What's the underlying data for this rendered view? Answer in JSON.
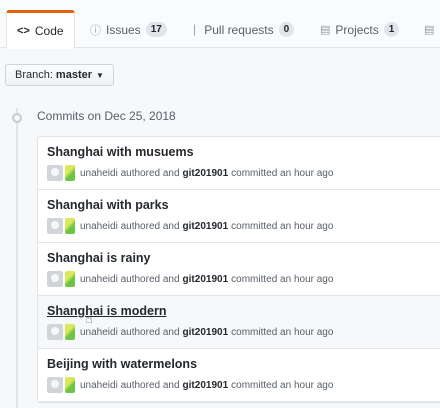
{
  "tabs": [
    {
      "icon": "<>",
      "label": "Code",
      "selected": true
    },
    {
      "icon": "ⓘ",
      "label": "Issues",
      "count": "17"
    },
    {
      "icon": "❘",
      "label": "Pull requests",
      "count": "0"
    },
    {
      "icon": "▤",
      "label": "Projects",
      "count": "1"
    },
    {
      "icon": "▤",
      "label": ""
    }
  ],
  "branch": {
    "prefix": "Branch:",
    "name": "master"
  },
  "commits_header": "Commits on Dec 25, 2018",
  "commits": [
    {
      "title": "Shanghai with musuems",
      "author": "unaheidi",
      "authored_text": "authored and",
      "committer": "git201901",
      "committed_text": "committed an hour ago"
    },
    {
      "title": "Shanghai with parks",
      "author": "unaheidi",
      "authored_text": "authored and",
      "committer": "git201901",
      "committed_text": "committed an hour ago"
    },
    {
      "title": "Shanghai is rainy",
      "author": "unaheidi",
      "authored_text": "authored and",
      "committer": "git201901",
      "committed_text": "committed an hour ago"
    },
    {
      "title": "Shanghai is modern",
      "author": "unaheidi",
      "authored_text": "authored and",
      "committer": "git201901",
      "committed_text": "committed an hour ago"
    },
    {
      "title": "Beijing with watermelons",
      "author": "unaheidi",
      "authored_text": "authored and",
      "committer": "git201901",
      "committed_text": "committed an hour ago"
    }
  ],
  "colors": {
    "accent": "#e36209",
    "text": "#24292e",
    "muted": "#586069"
  }
}
